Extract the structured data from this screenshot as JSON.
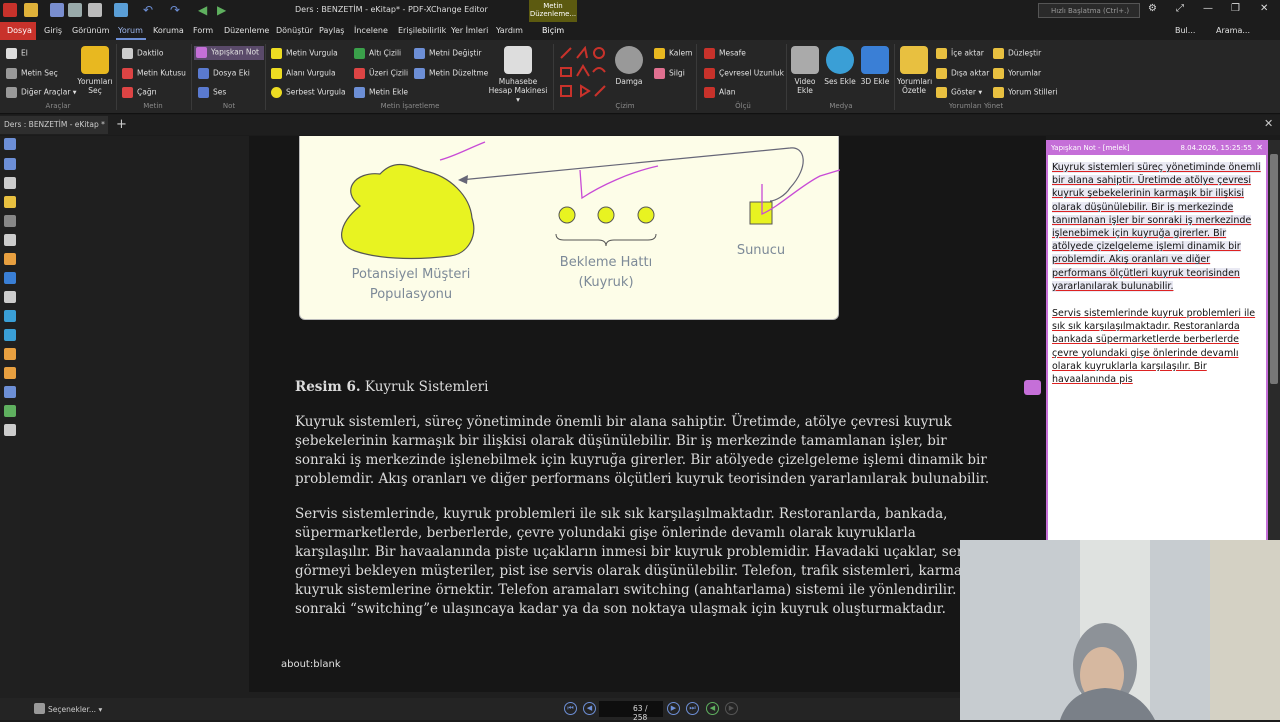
{
  "window": {
    "title": "Ders : BENZETİM - eKitap* - PDF-XChange Editor",
    "context_tab": "Metin Düzenleme...",
    "search_placeholder": "Hızlı Başlatma (Ctrl+.)",
    "right_tools": [
      "Bul...",
      "Arama..."
    ]
  },
  "menu": {
    "active_file": "Dosya",
    "tabs": [
      "Giriş",
      "Görünüm",
      "Yorum",
      "Koruma",
      "Form",
      "Düzenleme",
      "Dönüştür",
      "Paylaş",
      "İncelene",
      "Erişilebilirlik",
      "Yer İmleri",
      "Yardım",
      "Biçim"
    ],
    "active": "Yorum"
  },
  "ribbon": {
    "araclar": {
      "items": [
        "El",
        "Metin Seç",
        "Diğer Araçlar"
      ],
      "big": "Yorumları Seç",
      "group": "Araçlar"
    },
    "metin": {
      "items": [
        "Daktilo",
        "Metin Kutusu",
        "Çağrı"
      ],
      "group": "Metin"
    },
    "not": {
      "items": [
        "Yapışkan Not",
        "Dosya Eki",
        "Ses"
      ],
      "group": "Not"
    },
    "metin_isaretleme": {
      "items": [
        "Metin Vurgula",
        "Alanı Vurgula",
        "Serbest Vurgula",
        "Altı Çizili",
        "Üzeri Çizili",
        "Metin Ekle",
        "Metni Değiştir",
        "Metin Düzeltme"
      ],
      "big": "Muhasebe Hesap Makinesi",
      "group": "Metin İşaretleme"
    },
    "cizim": {
      "big": "Damga",
      "items": [
        "Kalem",
        "Silgi"
      ],
      "group": "Çizim"
    },
    "olcu": {
      "items": [
        "Mesafe",
        "Çevresel Uzunluk",
        "Alan"
      ],
      "group": "Ölçü"
    },
    "medya": {
      "items": [
        "Video Ekle",
        "Ses Ekle",
        "3D Ekle"
      ],
      "group": "Medya"
    },
    "yonet": {
      "big": "Yorumları Özetle",
      "items": [
        "İçe aktar",
        "Dışa aktar",
        "Göster",
        "Düzleştir",
        "Yorumlar",
        "Yorum Stilleri"
      ],
      "group": "Yorumları Yönet"
    }
  },
  "doc_tab": "Ders : BENZETİM - eKitap *",
  "figure": {
    "label_left": "Potansiyel Müşteri\nPopulasyonu",
    "label_mid": "Bekleme Hattı\n(Kuyruk)",
    "label_right": "Sunucu"
  },
  "document": {
    "caption_bold": "Resim 6.",
    "caption_rest": " Kuyruk Sistemleri",
    "paragraph1": "Kuyruk sistemleri, süreç yönetiminde önemli bir alana sahiptir. Üretimde, atölye çevresi kuyruk şebekelerinin karmaşık bir ilişkisi olarak düşünülebilir. Bir iş merkezinde tamamlanan işler, bir sonraki iş merkezinde işlenebilmek için kuyruğa girerler. Bir atölyede çizelgeleme işlemi dinamik bir problemdir. Akış oranları ve diğer performans ölçütleri kuyruk teorisinden yararlanılarak bulunabilir.",
    "paragraph2": "Servis sistemlerinde, kuyruk problemleri ile sık sık karşılaşılmaktadır. Restoranlarda, bankada, süpermarketlerde, berberlerde, çevre yolundaki gişe önlerinde devamlı olarak kuyruklarla karşılaşılır. Bir havaalanında piste uçakların inmesi bir kuyruk problemidir. Havadaki uçaklar, servis görmeyi bekleyen müşteriler, pist ise servis olarak düşünülebilir. Telefon, trafik sistemleri, karmaşık kuyruk sistemlerine örnektir. Telefon aramaları switching (anahtarlama) sistemi ile yönlendirilir. Bir sonraki “switching”e ulaşıncaya kadar ya da son noktaya ulaşmak için kuyruk oluşturmaktadır.",
    "status_text": "about:blank"
  },
  "sticky_note": {
    "title": "Yapışkan Not - [melek]",
    "date": "8.04.2026, 15:25:55",
    "text1": "Kuyruk sistemleri süreç yönetiminde önemli bir alana sahiptir. Üretimde atölye çevresi kuyruk şebekelerinin karmaşık bir ilişkisi olarak düşünülebilir. Bir  iş merkezinde tanımlanan işler bir sonraki iş merkezinde işlenebimek için kuyruğa girerler. Bir atölyede çizelgeleme işlemi dinamik bir problemdir. Akış oranları ve diğer performans ölçütleri kuyruk teorisinden yararlanılarak bulunabilir.",
    "text2": "Servis sistemlerinde kuyruk problemleri ile sık sık karşılaşılmaktadır. Restoranlarda bankada süpermarketlerde berberlerde çevre yolundaki gişe önlerinde devamlı olarak kuyruklarla karşılaşılır. Bir havaalanında pis"
  },
  "statusbar": {
    "options": "Seçenekler...",
    "page_current": "63",
    "page_total": "/ 258"
  },
  "colors": {
    "accent": "#c56fd8",
    "file_tab": "#c8322b",
    "active_tab": "#6d8fd6",
    "figure_yellow": "#e8f321"
  }
}
